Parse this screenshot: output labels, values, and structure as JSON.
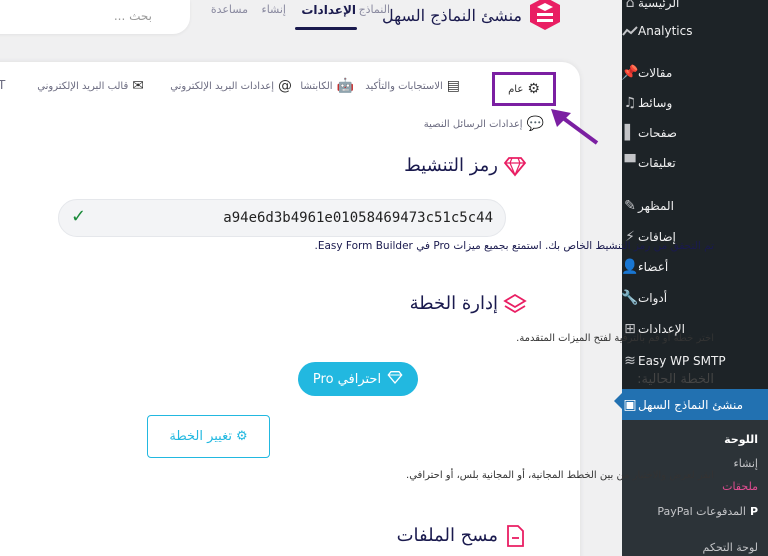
{
  "admin_menu": {
    "items": [
      {
        "label": "الرئيسية",
        "icon": "home-icon"
      },
      {
        "label": "Analytics",
        "icon": "analytics-icon"
      },
      {
        "label": "مقالات",
        "icon": "pin-icon"
      },
      {
        "label": "وسائط",
        "icon": "media-icon"
      },
      {
        "label": "صفحات",
        "icon": "pages-icon"
      },
      {
        "label": "تعليقات",
        "icon": "comments-icon"
      },
      {
        "label": "المظهر",
        "icon": "appearance-icon"
      },
      {
        "label": "إضافات",
        "icon": "plugins-icon"
      },
      {
        "label": "أعضاء",
        "icon": "users-icon"
      },
      {
        "label": "أدوات",
        "icon": "tools-icon"
      },
      {
        "label": "الإعدادات",
        "icon": "settings-icon"
      },
      {
        "label": "Easy WP SMTP",
        "icon": "smtp-icon"
      },
      {
        "label": "منشئ النماذج السهل",
        "icon": "form-builder-icon"
      }
    ],
    "submenu": [
      {
        "label": "اللوحة"
      },
      {
        "label": "إنشاء"
      },
      {
        "label": "ملحقات"
      },
      {
        "label": "PayPal المدفوعات"
      },
      {
        "label": "لوحة التحكم"
      }
    ]
  },
  "topbar": {
    "brand": "منشئ النماذج السهل",
    "nav": [
      "النماذج",
      "الإعدادات",
      "إنشاء",
      "مساعدة"
    ],
    "search_placeholder": "بحث ..."
  },
  "tabs": {
    "general": "عام",
    "responses": "الاستجابات والتأكيد",
    "captcha": "الكابتشا",
    "email_settings": "إعدادات البريد الإلكتروني",
    "email_template": "قالب البريد الإلكتروني",
    "sms_settings": "إعدادات الرسائل النصية",
    "cut_letter": "T"
  },
  "activation": {
    "title": "رمز التنشيط",
    "key": "a94e6d3b4961e01058469473c51c5c44",
    "verified_msg": "تم التحقق من رمز التنشيط الخاص بك. استمتع بجميع ميزات Pro في Easy Form Builder."
  },
  "plan": {
    "title": "إدارة الخطة",
    "subtitle": "اختر خطة أو قم بالترقية لفتح الميزات المتقدمة.",
    "current_label": "الخطة الحالية:",
    "current_value": "احترافي Pro",
    "change_button": "تغيير الخطة",
    "hint": "انقر لعرض والاختيار من بين الخطط المجانية، أو المجانية بلس، أو احترافي."
  },
  "files": {
    "title": "مسح الملفات"
  },
  "colors": {
    "accent": "#22b8e0",
    "brand": "#e91e63",
    "navy": "#1a1a4e",
    "highlight": "#7b1fa2",
    "wp_active": "#2271b1"
  }
}
